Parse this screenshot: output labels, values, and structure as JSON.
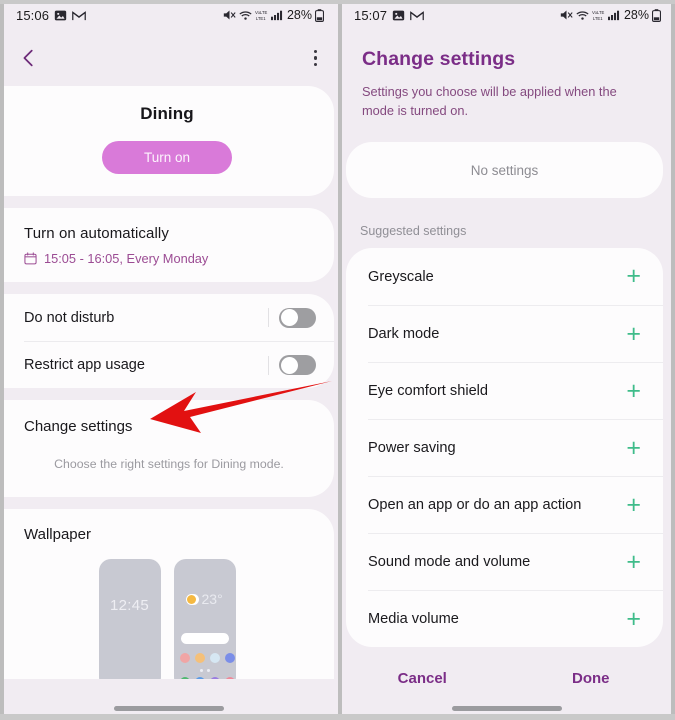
{
  "left": {
    "status": {
      "time": "15:06",
      "battery": "28%",
      "icons": [
        "image-icon",
        "gmail-icon",
        "mute-icon",
        "wifi-icon",
        "volte-icon",
        "signal-icon",
        "battery-icon"
      ]
    },
    "nav": {
      "back": "back-chevron",
      "more": "more-options"
    },
    "hero": {
      "title": "Dining",
      "turn_on_label": "Turn on"
    },
    "auto": {
      "title": "Turn on automatically",
      "schedule": "15:05 - 16:05, Every Monday"
    },
    "toggles": [
      {
        "label": "Do not disturb",
        "on": false
      },
      {
        "label": "Restrict app usage",
        "on": false
      }
    ],
    "change": {
      "title": "Change settings",
      "subtitle": "Choose the right settings for Dining mode."
    },
    "wallpaper": {
      "title": "Wallpaper",
      "thumb1_clock": "12:45",
      "thumb2_temp": "23°"
    }
  },
  "right": {
    "status": {
      "time": "15:07",
      "battery": "28%"
    },
    "title": "Change settings",
    "description": "Settings you choose will be applied when the mode is turned on.",
    "no_settings": "No settings",
    "suggested_label": "Suggested settings",
    "suggested": [
      {
        "label": "Greyscale",
        "action": "add"
      },
      {
        "label": "Dark mode",
        "action": "add"
      },
      {
        "label": "Eye comfort shield",
        "action": "add"
      },
      {
        "label": "Power saving",
        "action": "add"
      },
      {
        "label": "Open an app or do an app action",
        "action": "add"
      },
      {
        "label": "Sound mode and volume",
        "action": "add"
      },
      {
        "label": "Media volume",
        "action": "add"
      }
    ],
    "footer": {
      "cancel": "Cancel",
      "done": "Done"
    }
  },
  "annotation": {
    "arrow_color": "#e21111",
    "points_to": "change-settings-row"
  },
  "colors": {
    "accent": "#7b2d87",
    "button": "#d97ad9",
    "plus": "#3fbc8a",
    "bg": "#f1ecf2",
    "card": "#fdfcfd"
  }
}
